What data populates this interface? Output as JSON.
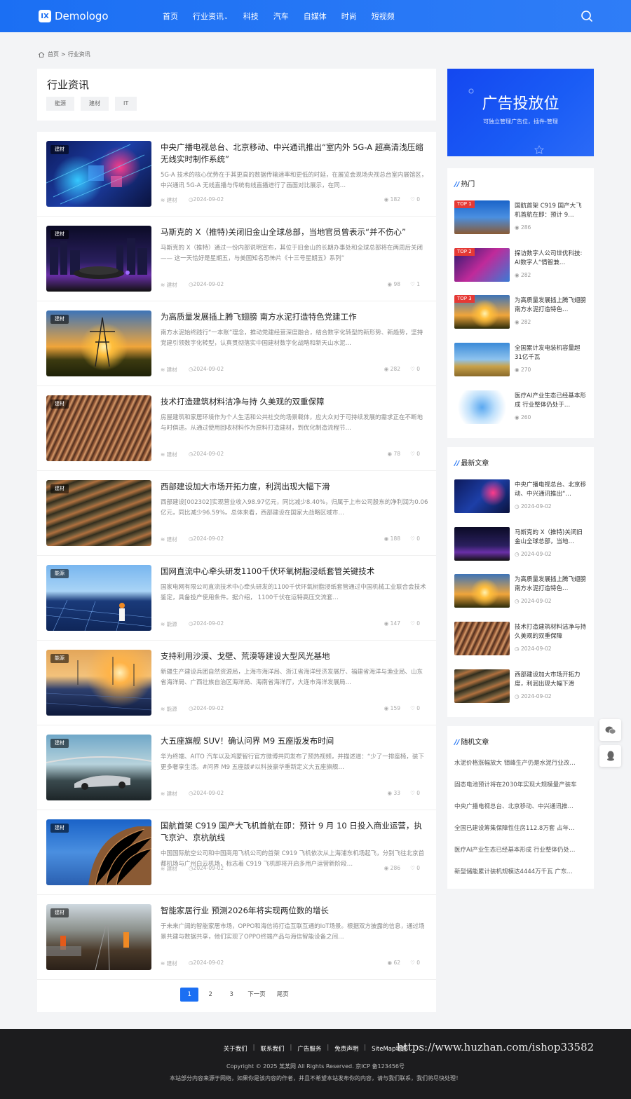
{
  "header": {
    "logo_mark": "IX",
    "logo_text": "Demologo",
    "nav": [
      "首页",
      "行业资讯",
      "科技",
      "汽车",
      "自媒体",
      "时尚",
      "短视频"
    ],
    "nav_caret": "⌄"
  },
  "breadcrumb": {
    "home": "首页",
    "sep": ">",
    "current": "行业资讯"
  },
  "category": {
    "title": "行业资讯",
    "tags": [
      "能源",
      "建材",
      "IT"
    ]
  },
  "articles": [
    {
      "tag": "建材",
      "title": "中央广播电视总台、北京移动、中兴通讯推出“室内外 5G-A 超高清浅压缩无线实时制作系统”",
      "desc": "5G-A 技术的核心优势在于其更高的数据传输速率和更低的时延，在展览会现场央视总台室内展馆区，中兴通讯 5G-A 无线直播与传统有线直播进行了画面对比展示，在同…",
      "cat": "建材",
      "date": "2024-09-02",
      "views": "182",
      "likes": "0"
    },
    {
      "tag": "建材",
      "title": "马斯克的 X（推特)关闭旧金山全球总部，当地官员曾表示“并不伤心”",
      "desc": "马斯克的 X（推特）通过一份内部说明宣布，其位于旧金山的长期办事处和全球总部将在两周后关闭 —— 这一天恰好是星期五，与美国知名恐怖片《十三号星期五》系列”",
      "cat": "建材",
      "date": "2024-09-02",
      "views": "98",
      "likes": "1"
    },
    {
      "tag": "建材",
      "title": "为高质量发展插上腾飞翅膀 南方水泥打造特色党建工作",
      "desc": "南方水泥始终践行“一本账”理念，推动党建经营深度融合，结合数字化转型的新形势、新趋势，坚持党建引领数字化转型，认真贯彻落实中国建材数字化战略和新天山水泥…",
      "cat": "建材",
      "date": "2024-09-02",
      "views": "282",
      "likes": "0"
    },
    {
      "tag": "建材",
      "title": "技术打造建筑材料洁净与持 久美观的双重保障",
      "desc": "房屋建筑和家居环境作为个人生活和公共社交的场景载体，应大众对于可持续发展的需求正在不断地与时俱进。从通过使用回收材料作为原料打造建材，到优化制造流程节…",
      "cat": "建材",
      "date": "2024-09-02",
      "views": "78",
      "likes": "0"
    },
    {
      "tag": "建材",
      "title": "西部建设加大市场开拓力度，利润出现大幅下滑",
      "desc": "西部建设[002302]实现营业收入98.97亿元，同比减少8.40%，归属于上市公司股东的净利润为0.06亿元，同比减少96.59%。总体来看，西部建设在国家大战略区域市…",
      "cat": "建材",
      "date": "2024-09-02",
      "views": "188",
      "likes": "0"
    },
    {
      "tag": "能源",
      "title": "国网直流中心牵头研发1100千伏环氧树脂浸纸套管关键技术",
      "desc": "国家电网有限公司直流技术中心牵头研发的1100千伏环氧树脂浸纸套管通过中国机械工业联合会技术鉴定，具备投产使用条件。据介绍， 1100千伏在运特高压交流套…",
      "cat": "能源",
      "date": "2024-09-02",
      "views": "147",
      "likes": "0"
    },
    {
      "tag": "能源",
      "title": "支持利用沙漠、戈壁、荒漠等建设大型风光基地",
      "desc": "新疆生产建设兵团自然资源局，上海市海洋局、浙江省海洋经济发展厅、福建省海洋与渔业局、山东省海洋局、广西壮族自治区海洋局、海南省海洋厅，大连市海洋发展局…",
      "cat": "能源",
      "date": "2024-09-02",
      "views": "159",
      "likes": "0"
    },
    {
      "tag": "建材",
      "title": "大五座旗舰 SUV！确认问界 M9 五座版发布时间",
      "desc": "华为终端、AITO 汽车以及鸿蒙智行官方微博共同发布了预热视频，并描述道：“少了一排座椅，装下更多奢享生活。#问界 M9 五座版#以科技豪华重新定义大五座旗舰…",
      "cat": "建材",
      "date": "2024-09-02",
      "views": "33",
      "likes": "0"
    },
    {
      "tag": "建材",
      "title": "国航首架 C919 国产大飞机首航在即：预计 9 月 10 日投入商业运营，执飞京沪、京杭航线",
      "desc": "中国国际航空公司和中国商用飞机公司的首架 C919 飞机依次从上海浦东机场起飞，分别飞往北京首都机场与广州白云机场，标志着 C919 飞机即将开启多用户运营新阶段…",
      "cat": "建材",
      "date": "2024-09-02",
      "views": "286",
      "likes": "0"
    },
    {
      "tag": "建材",
      "title": "智能家居行业 预测2026年将实现两位数的增长",
      "desc": "于未来广阔的智能家居市场，OPPO和海信将打造互联互通的IoT场景。根据双方披露的信息，通过场景共建与数据共享，他们实现了OPPO终端产品与海信智能设备之间…",
      "cat": "建材",
      "date": "2024-09-02",
      "views": "62",
      "likes": "0"
    }
  ],
  "pager": [
    "1",
    "2",
    "3",
    "下一页",
    "尾页"
  ],
  "ad": {
    "title": "广告投放位",
    "sub": "可独立管理广告位，插件-管理"
  },
  "hot": {
    "title": "热门",
    "items": [
      {
        "badge": "TOP 1",
        "title": "国航首架 C919 国产大飞机首航在即：预计 9…",
        "views": "286"
      },
      {
        "badge": "TOP 2",
        "title": "探访数字人公司世优科技: AI数字人“情智兼…",
        "views": "282"
      },
      {
        "badge": "TOP 3",
        "title": "为高质量发展插上腾飞翅膀 南方水泥打造特色…",
        "views": "282"
      },
      {
        "badge": "",
        "title": "全国累计发电装机容量超31亿千瓦",
        "views": "270"
      },
      {
        "badge": "",
        "title": "医疗AI产业生态已经基本形成 行业整体仍处于…",
        "views": "260"
      }
    ]
  },
  "latest": {
    "title": "最新文章",
    "items": [
      {
        "title": "中央广播电视总台、北京移动、中兴通讯推出“…",
        "date": "2024-09-02"
      },
      {
        "title": "马斯克的 X（推特)关闭旧金山全球总部，当地…",
        "date": "2024-09-02"
      },
      {
        "title": "为高质量发展插上腾飞翅膀 南方水泥打造特色…",
        "date": "2024-09-02"
      },
      {
        "title": "技术打造建筑材料洁净与持 久美观的双重保障",
        "date": "2024-09-02"
      },
      {
        "title": "西部建设加大市场开拓力度，利润出现大幅下滑",
        "date": "2024-09-02"
      }
    ]
  },
  "random": {
    "title": "随机文章",
    "items": [
      "水泥价格涨幅放大 钼峰生产仍是水泥行业改…",
      "固态电池预计将在2030年实现大规模量产装车",
      "中央广播电视总台、北京移动、中兴通讯推…",
      "全国已建设筹集保障性住房112.8万套 占年…",
      "医疗AI产业生态已经基本形成 行业整体仍处…",
      "新型储能累计装机规模达4444万千瓦 广东…"
    ]
  },
  "footer": {
    "links": [
      "关于我们",
      "联系我们",
      "广告服务",
      "免责声明",
      "SiteMap地图"
    ],
    "copyright": "Copyright © 2025 某某网 All Rights Reserved. 京ICP 备123456号",
    "note": "本站部分内容来源于网络，如果你是该内容的作者，并且不希望本站发布你的内容，请与我们联系，我们将尽快处理！",
    "watermark": "https://www.huzhan.com/ishop33582"
  }
}
